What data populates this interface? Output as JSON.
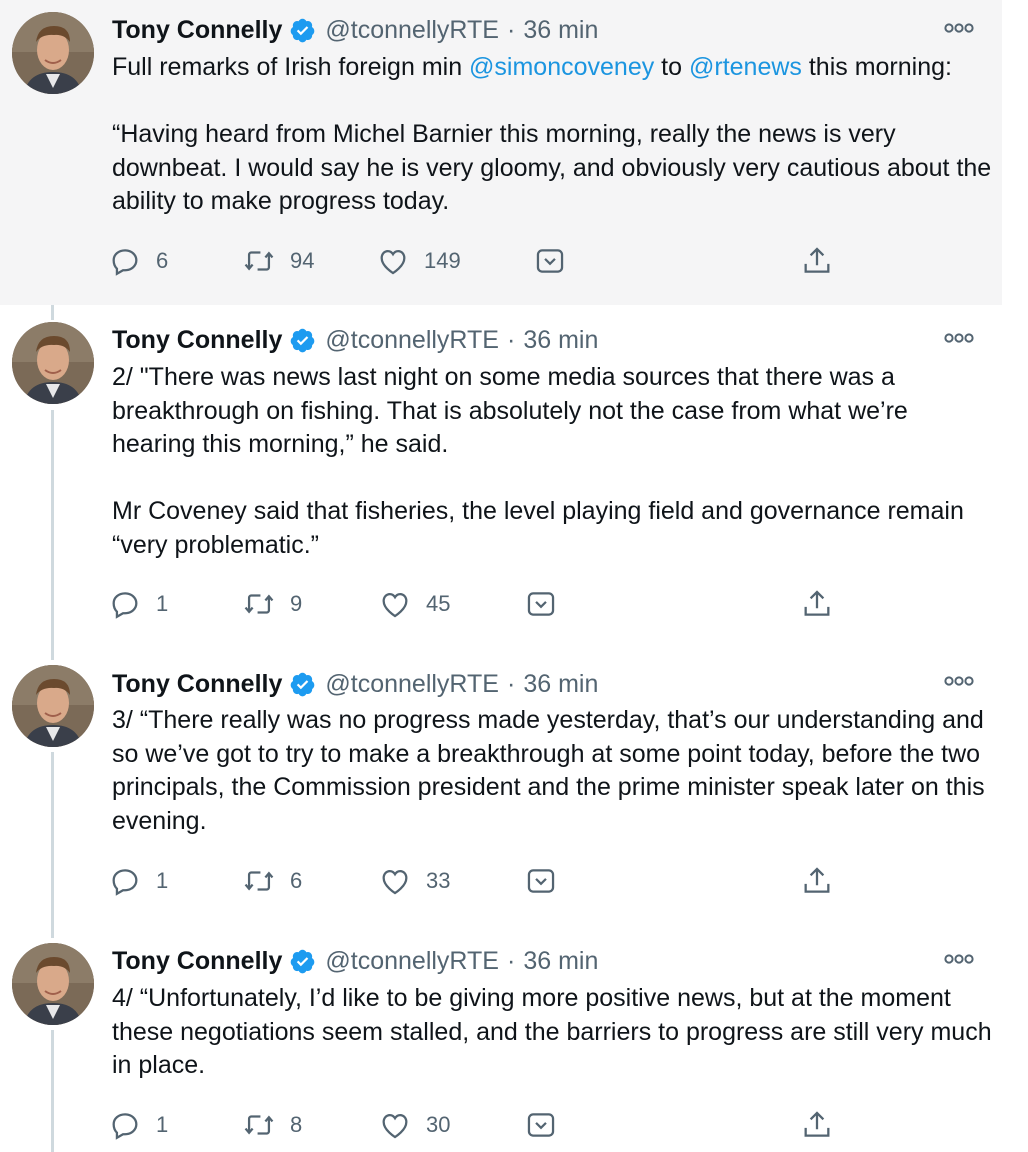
{
  "tweets": [
    {
      "name": "Tony Connelly",
      "handle": "@tconnellyRTE",
      "separator": "·",
      "time": "36 min",
      "body_parts": [
        {
          "p": [
            {
              "t": "Full remarks of Irish foreign min "
            },
            {
              "t": "@simoncoveney",
              "mention": true
            },
            {
              "t": " to "
            },
            {
              "t": "@rtenews",
              "mention": true
            },
            {
              "t": " this morning:"
            }
          ]
        },
        {
          "p": [
            {
              "t": "“Having heard from Michel Barnier this morning, really the news is very downbeat. I would say he is very gloomy, and obviously very cautious about the ability to make progress today."
            }
          ]
        }
      ],
      "replies": "6",
      "retweets": "94",
      "likes": "149"
    },
    {
      "name": "Tony Connelly",
      "handle": "@tconnellyRTE",
      "separator": "·",
      "time": "36 min",
      "body_parts": [
        {
          "p": [
            {
              "t": "2/ \"There was news last night on some media sources that there was a breakthrough on fishing. That is absolutely not the case from what we’re hearing this morning,” he said."
            }
          ]
        },
        {
          "p": [
            {
              "t": "Mr Coveney said that fisheries, the level playing field and governance remain “very problematic.”"
            }
          ]
        }
      ],
      "replies": "1",
      "retweets": "9",
      "likes": "45"
    },
    {
      "name": "Tony Connelly",
      "handle": "@tconnellyRTE",
      "separator": "·",
      "time": "36 min",
      "body_parts": [
        {
          "p": [
            {
              "t": "3/ “There really was no progress made yesterday, that’s our understanding and so we’ve got to try to make a breakthrough at some point today, before the two principals, the Commission president and the prime minister speak later on this evening."
            }
          ]
        }
      ],
      "replies": "1",
      "retweets": "6",
      "likes": "33"
    },
    {
      "name": "Tony Connelly",
      "handle": "@tconnellyRTE",
      "separator": "·",
      "time": "36 min",
      "body_parts": [
        {
          "p": [
            {
              "t": "4/ “Unfortunately, I’d like to be giving more positive news, but at the moment these negotiations seem stalled, and the barriers to progress are still very much in place."
            }
          ]
        }
      ],
      "replies": "1",
      "retweets": "8",
      "likes": "30"
    }
  ],
  "icons": {
    "verified": "verified-badge-icon",
    "more": "more-options-icon",
    "reply": "reply-icon",
    "retweet": "retweet-icon",
    "like": "like-icon",
    "save": "bookmark-icon",
    "share": "share-icon"
  },
  "colors": {
    "mention": "#1b95e0",
    "verified": "#1d9bf0",
    "highlight_bg": "#f5f5f6",
    "muted": "#536471",
    "thread_line": "#cfd9de"
  }
}
